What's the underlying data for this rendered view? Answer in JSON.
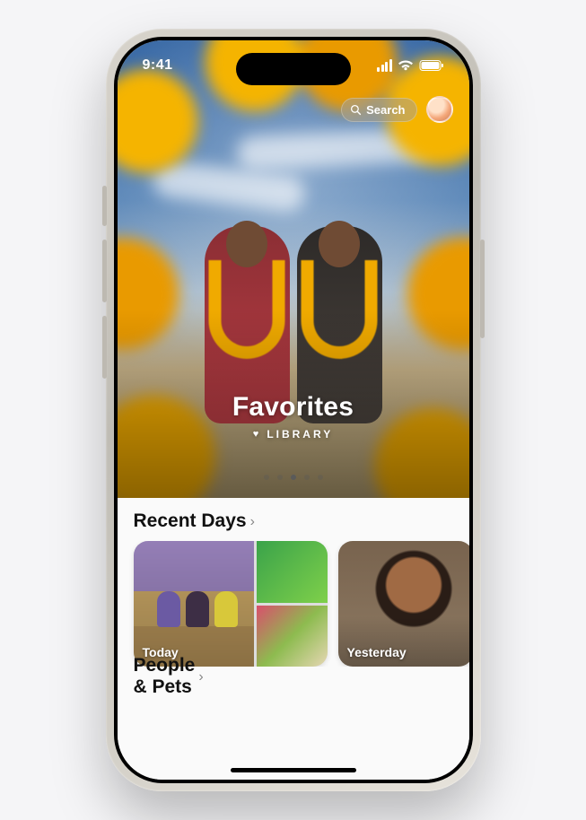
{
  "status": {
    "time": "9:41"
  },
  "header": {
    "search_label": "Search"
  },
  "hero": {
    "title": "Favorites",
    "subtitle": "LIBRARY",
    "page_dots": {
      "count": 5,
      "active_index": 2
    }
  },
  "sections": {
    "recent_days": {
      "title": "Recent Days",
      "items": [
        {
          "label": "Today"
        },
        {
          "label": "Yesterday"
        }
      ]
    },
    "people_pets": {
      "title": "People & Pets"
    }
  }
}
